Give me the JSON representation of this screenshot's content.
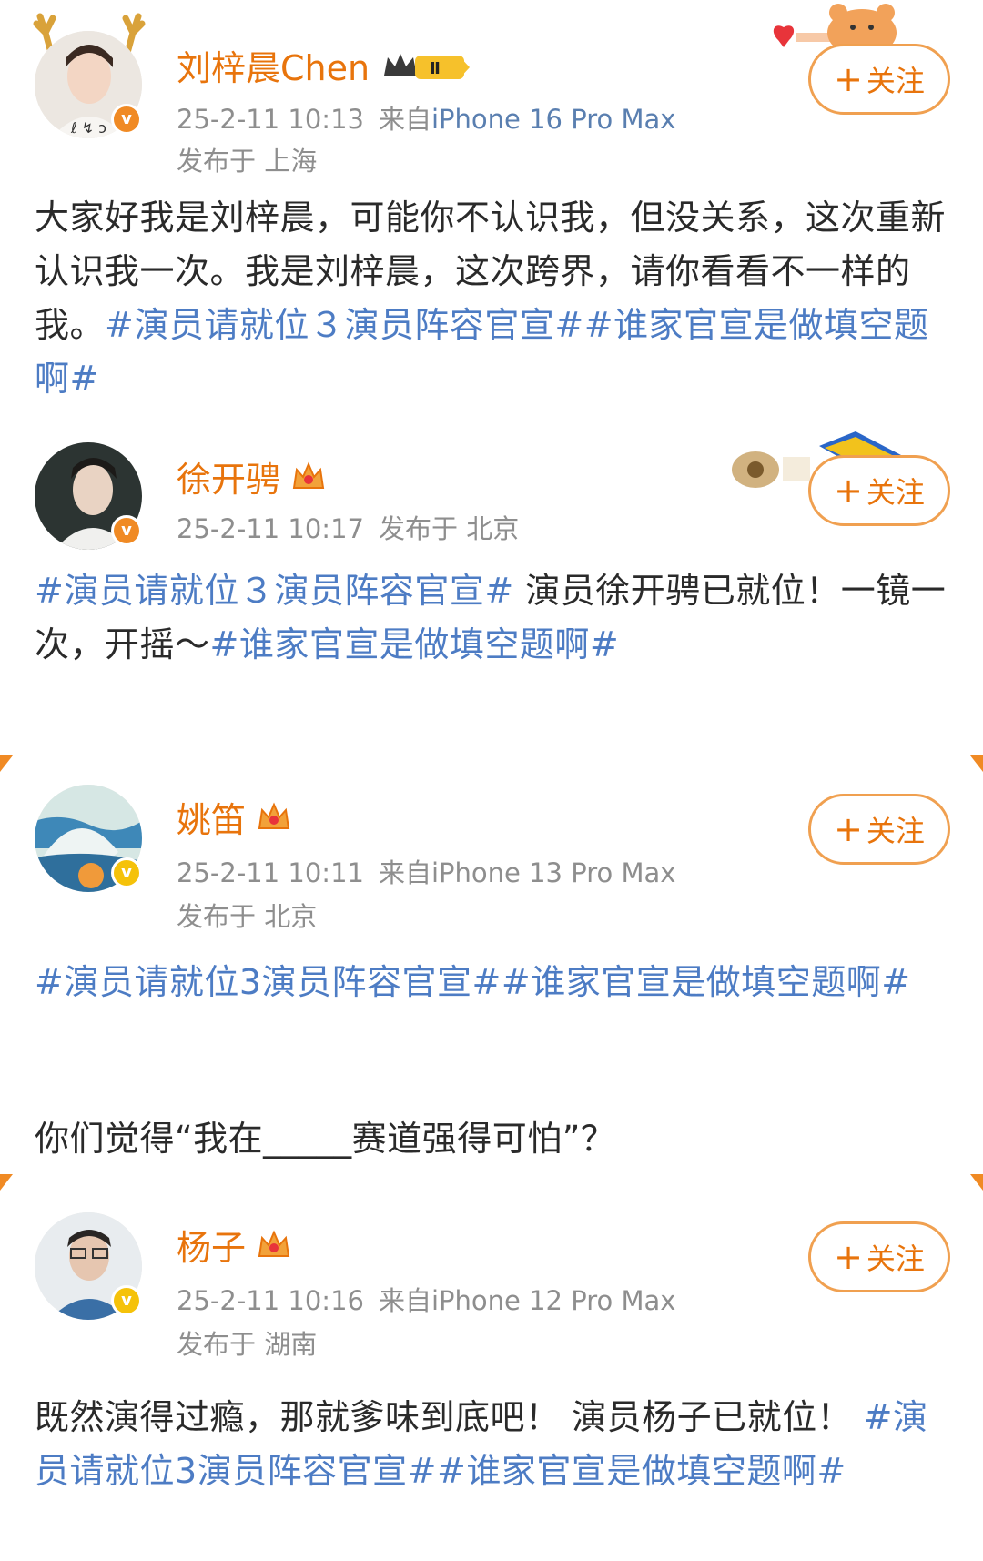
{
  "posts": [
    {
      "name": "刘梓晨Chen",
      "badge": "Ⅱ",
      "time": "25-2-11 10:13",
      "source_prefix": "来自",
      "device": "iPhone 16 Pro Max",
      "location": "发布于 上海",
      "follow": "关注",
      "body_text": "大家好我是刘梓晨，可能你不认识我，但没关系，这次重新认识我一次。我是刘梓晨，这次跨界，请你看看不一样的我。",
      "tags": [
        "#演员请就位３演员阵容官宣#",
        "#谁家官宣是做填空题啊#"
      ],
      "avatar_icon": "avatar-photo-with-antlers",
      "verified_color": "#f08a24"
    },
    {
      "name": "徐开骋",
      "time": "25-2-11 10:17",
      "location": "发布于 北京",
      "follow": "关注",
      "tag1": "#演员请就位３演员阵容官宣#",
      "body_text": " 演员徐开骋已就位！一镜一次，开摇～",
      "tag2": "#谁家官宣是做填空题啊#",
      "avatar_icon": "avatar-photo",
      "verified_color": "#f08a24"
    },
    {
      "name": "姚笛",
      "time": "25-2-11 10:11",
      "source_prefix": "来自",
      "device": "iPhone 13 Pro Max",
      "location": "发布于 北京",
      "follow": "关注",
      "tags": "#演员请就位3演员阵容官宣##谁家官宣是做填空题啊#",
      "body_text": "你们觉得“我在_____赛道强得可怕”？",
      "avatar_icon": "avatar-painting",
      "verified_color": "#f5c20a"
    },
    {
      "name": "杨子",
      "time": "25-2-11 10:16",
      "source_prefix": "来自",
      "device": "iPhone 12 Pro Max",
      "location": "发布于 湖南",
      "follow": "关注",
      "body_text": "既然演得过瘾，那就爹味到底吧！ 演员杨子已就位！ ",
      "tags": "#演员请就位3演员阵容官宣##谁家官宣是做填空题啊#",
      "avatar_icon": "avatar-photo",
      "verified_color": "#f5c20a"
    }
  ],
  "icons": {
    "crown": "crown-icon",
    "verified": "verified-v-icon",
    "follow_plus": "plus-icon"
  }
}
